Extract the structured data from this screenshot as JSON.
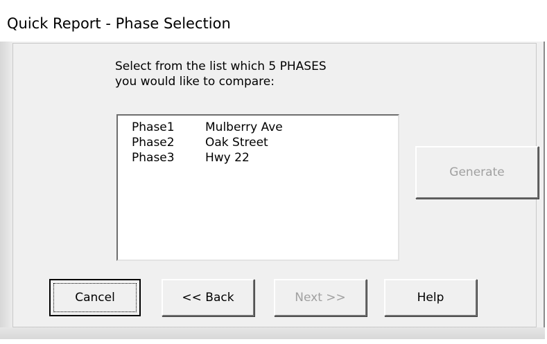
{
  "window": {
    "title": "Quick Report - Phase Selection"
  },
  "instructions": {
    "text": "Select from the list which 5 PHASES\nyou would like to compare:"
  },
  "phase_list": {
    "items": [
      {
        "phase": "Phase1",
        "name": "Mulberry Ave"
      },
      {
        "phase": "Phase2",
        "name": "Oak Street"
      },
      {
        "phase": "Phase3",
        "name": "Hwy 22"
      }
    ]
  },
  "buttons": {
    "generate": {
      "label": "Generate",
      "enabled": false
    },
    "cancel": {
      "label": "Cancel",
      "enabled": true,
      "default": true
    },
    "back": {
      "label": "<< Back",
      "enabled": true
    },
    "next": {
      "label": "Next >>",
      "enabled": false
    },
    "help": {
      "label": "Help",
      "enabled": true
    }
  }
}
